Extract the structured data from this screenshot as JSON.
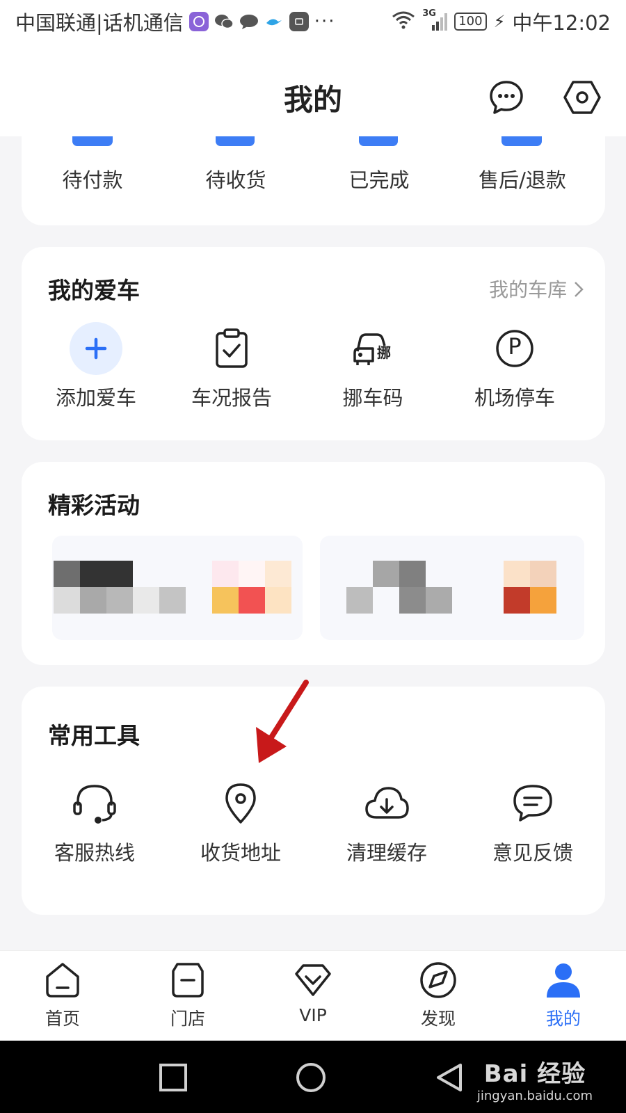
{
  "status_bar": {
    "carrier": "中国联通|话机通信",
    "network": "3G",
    "battery": "100",
    "time": "中午12:02"
  },
  "header": {
    "title": "我的",
    "icons": [
      "message-icon",
      "settings-icon"
    ]
  },
  "orders": {
    "items": [
      {
        "label": "待付款"
      },
      {
        "label": "待收货"
      },
      {
        "label": "已完成"
      },
      {
        "label": "售后/退款"
      }
    ]
  },
  "my_car": {
    "title": "我的爱车",
    "garage_link": "我的车库",
    "items": [
      {
        "label": "添加爱车",
        "icon": "plus-icon"
      },
      {
        "label": "车况报告",
        "icon": "clipboard-check-icon"
      },
      {
        "label": "挪车码",
        "icon": "move-car-icon",
        "icon_text": "挪"
      },
      {
        "label": "机场停车",
        "icon": "parking-icon",
        "icon_text": "P"
      }
    ]
  },
  "activities": {
    "title": "精彩活动"
  },
  "tools": {
    "title": "常用工具",
    "items": [
      {
        "label": "客服热线",
        "icon": "headset-icon"
      },
      {
        "label": "收货地址",
        "icon": "location-pin-icon"
      },
      {
        "label": "清理缓存",
        "icon": "cloud-download-icon"
      },
      {
        "label": "意见反馈",
        "icon": "feedback-bubble-icon"
      }
    ]
  },
  "tab_bar": {
    "items": [
      {
        "label": "首页",
        "icon": "home-icon"
      },
      {
        "label": "门店",
        "icon": "store-icon"
      },
      {
        "label": "VIP",
        "icon": "vip-diamond-icon"
      },
      {
        "label": "发现",
        "icon": "discover-compass-icon"
      },
      {
        "label": "我的",
        "icon": "profile-icon",
        "active": true
      }
    ]
  },
  "watermark": {
    "main": "Bai 经验",
    "sub": "jingyan.baidu.com"
  },
  "colors": {
    "accent": "#2b6ff6",
    "annotation_arrow": "#c8191a"
  }
}
